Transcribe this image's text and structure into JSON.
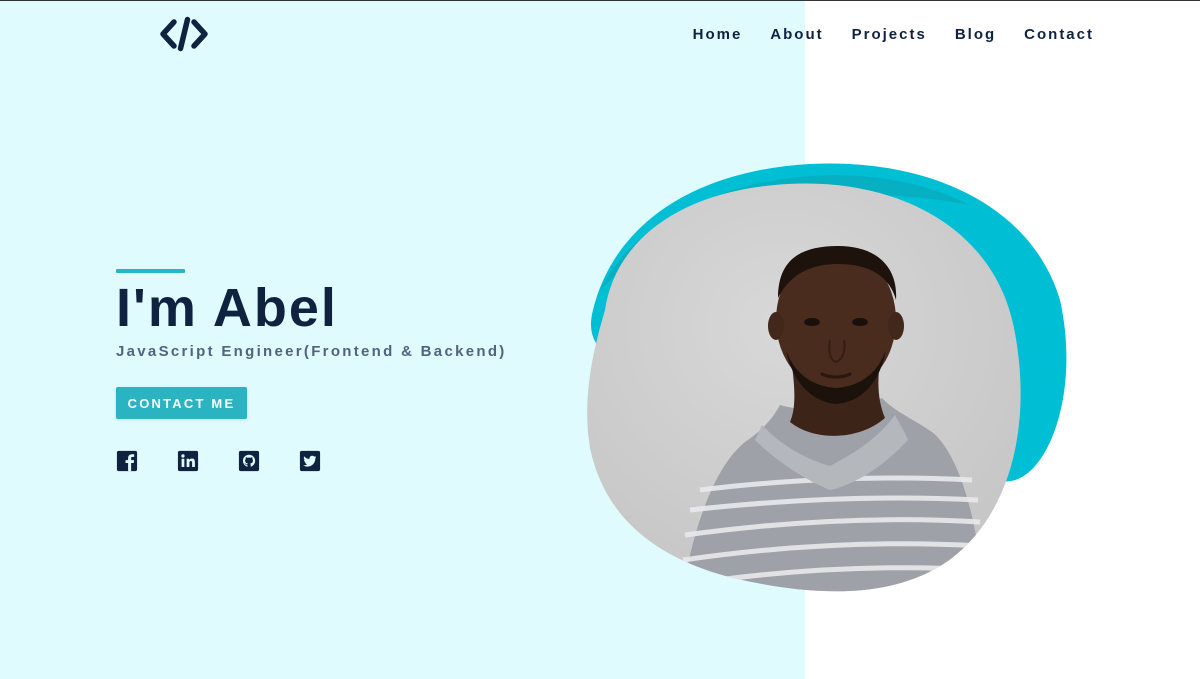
{
  "brand": {
    "logo_icon": "code-brackets-icon"
  },
  "nav": {
    "items": [
      {
        "label": "Home"
      },
      {
        "label": "About"
      },
      {
        "label": "Projects"
      },
      {
        "label": "Blog"
      },
      {
        "label": "Contact"
      }
    ]
  },
  "hero": {
    "title": "I'm Abel",
    "subtitle": "JavaScript Engineer(Frontend & Backend)",
    "cta_label": "CONTACT ME",
    "socials": [
      {
        "icon": "facebook-icon"
      },
      {
        "icon": "linkedin-icon"
      },
      {
        "icon": "github-icon"
      },
      {
        "icon": "twitter-icon"
      }
    ],
    "portrait": "profile-photo"
  },
  "colors": {
    "navy": "#0f2340",
    "accent": "#2ab3c0",
    "light_bg": "#e0fbfe",
    "subtitle": "#51637e",
    "blob": "#00c4d6"
  }
}
